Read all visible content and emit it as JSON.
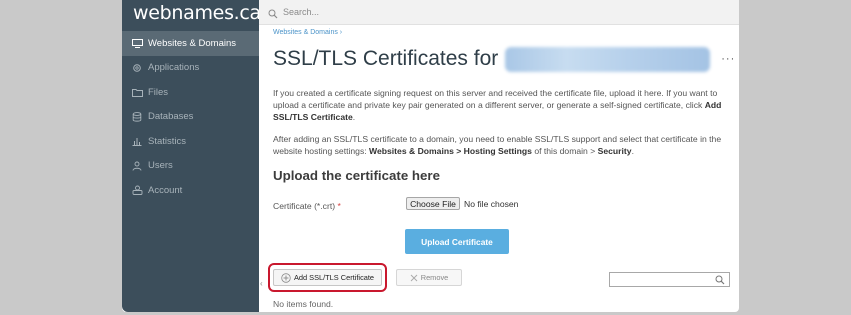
{
  "sidebar": {
    "logo_main": "webnames.ca",
    "logo_sup": "®",
    "items": [
      {
        "label": "Websites & Domains",
        "icon": "monitor-icon",
        "active": true
      },
      {
        "label": "Applications",
        "icon": "gear-icon",
        "active": false
      },
      {
        "label": "Files",
        "icon": "folder-icon",
        "active": false
      },
      {
        "label": "Databases",
        "icon": "database-icon",
        "active": false
      },
      {
        "label": "Statistics",
        "icon": "bar-chart-icon",
        "active": false
      },
      {
        "label": "Users",
        "icon": "user-icon",
        "active": false
      },
      {
        "label": "Account",
        "icon": "account-icon",
        "active": false
      }
    ]
  },
  "topbar": {
    "search_placeholder": "Search...",
    "help_icon": "help-icon"
  },
  "main": {
    "breadcrumb": "Websites & Domains  ›",
    "title": "SSL/TLS Certificates for",
    "more_label": "···",
    "intro_a": "If you created a certificate signing request on this server and received the certificate file, upload it here. If you want to upload a certificate and private key pair generated on a different server, or generate a self-signed certificate, click ",
    "intro_b": "Add SSL/TLS Certificate",
    "intro_c": ".",
    "info_a": "After adding an SSL/TLS certificate to a domain, you need to enable SSL/TLS support and select that certificate in the website hosting settings: ",
    "info_b": "Websites & Domains > Hosting Settings",
    "info_c": " of this domain > ",
    "info_d": "Security",
    "info_e": ".",
    "upload_heading": "Upload the certificate here",
    "cert_label": "Certificate (*.crt)",
    "required_mark": "*",
    "choose_file_label": "Choose File",
    "no_file_text": "No file chosen",
    "upload_button": "Upload Certificate",
    "add_button": "Add SSL/TLS Certificate",
    "remove_button": "Remove",
    "list_search_placeholder": "",
    "no_items": "No items found.",
    "collapse_arrow": "‹"
  },
  "colors": {
    "sidebar_bg": "#3c4e5b",
    "active_item_bg": "#5a6a75",
    "primary_button": "#5aaee0",
    "highlight_border": "#c9182e",
    "link": "#4c94c9"
  }
}
